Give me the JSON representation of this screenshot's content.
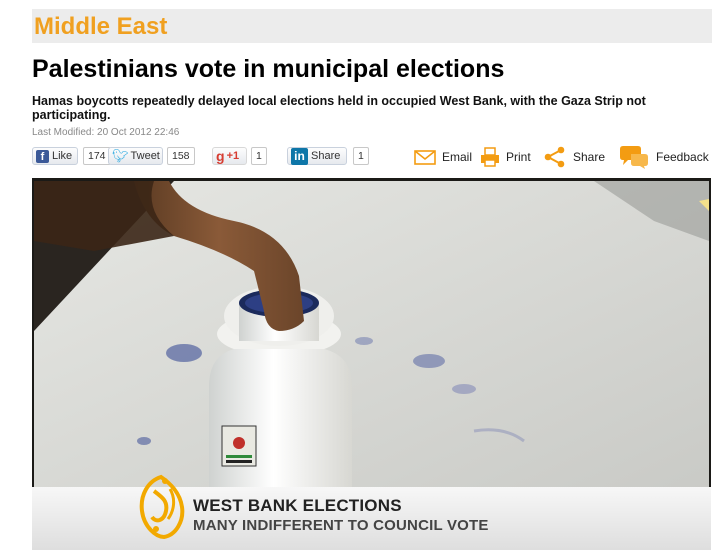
{
  "section": {
    "title": "Middle East"
  },
  "article": {
    "headline": "Palestinians vote in municipal elections",
    "subhead": "Hamas boycotts repeatedly delayed local elections held in occupied West Bank, with the Gaza Strip not participating.",
    "last_modified": "Last Modified: 20 Oct 2012 22:46"
  },
  "share": {
    "facebook": {
      "label": "Like",
      "count": "174",
      "icon": "facebook-icon"
    },
    "twitter": {
      "label": "Tweet",
      "count": "158",
      "icon": "twitter-bird-icon"
    },
    "googleplus": {
      "label": "+1",
      "count": "1",
      "icon": "google-icon"
    },
    "linkedin": {
      "label": "Share",
      "count": "1",
      "icon": "linkedin-icon"
    }
  },
  "actions": {
    "email": "Email",
    "print": "Print",
    "share": "Share",
    "feedback": "Feedback"
  },
  "video": {
    "lower_third_title": "WEST BANK ELECTIONS",
    "lower_third_subtitle": "MANY INDIFFERENT TO COUNCIL VOTE"
  },
  "colors": {
    "accent": "#f0a020",
    "action_icon": "#f39c12",
    "facebook": "#3b5998",
    "linkedin": "#0e76a8",
    "twitter": "#2aa9e0",
    "google": "#d73d32"
  }
}
